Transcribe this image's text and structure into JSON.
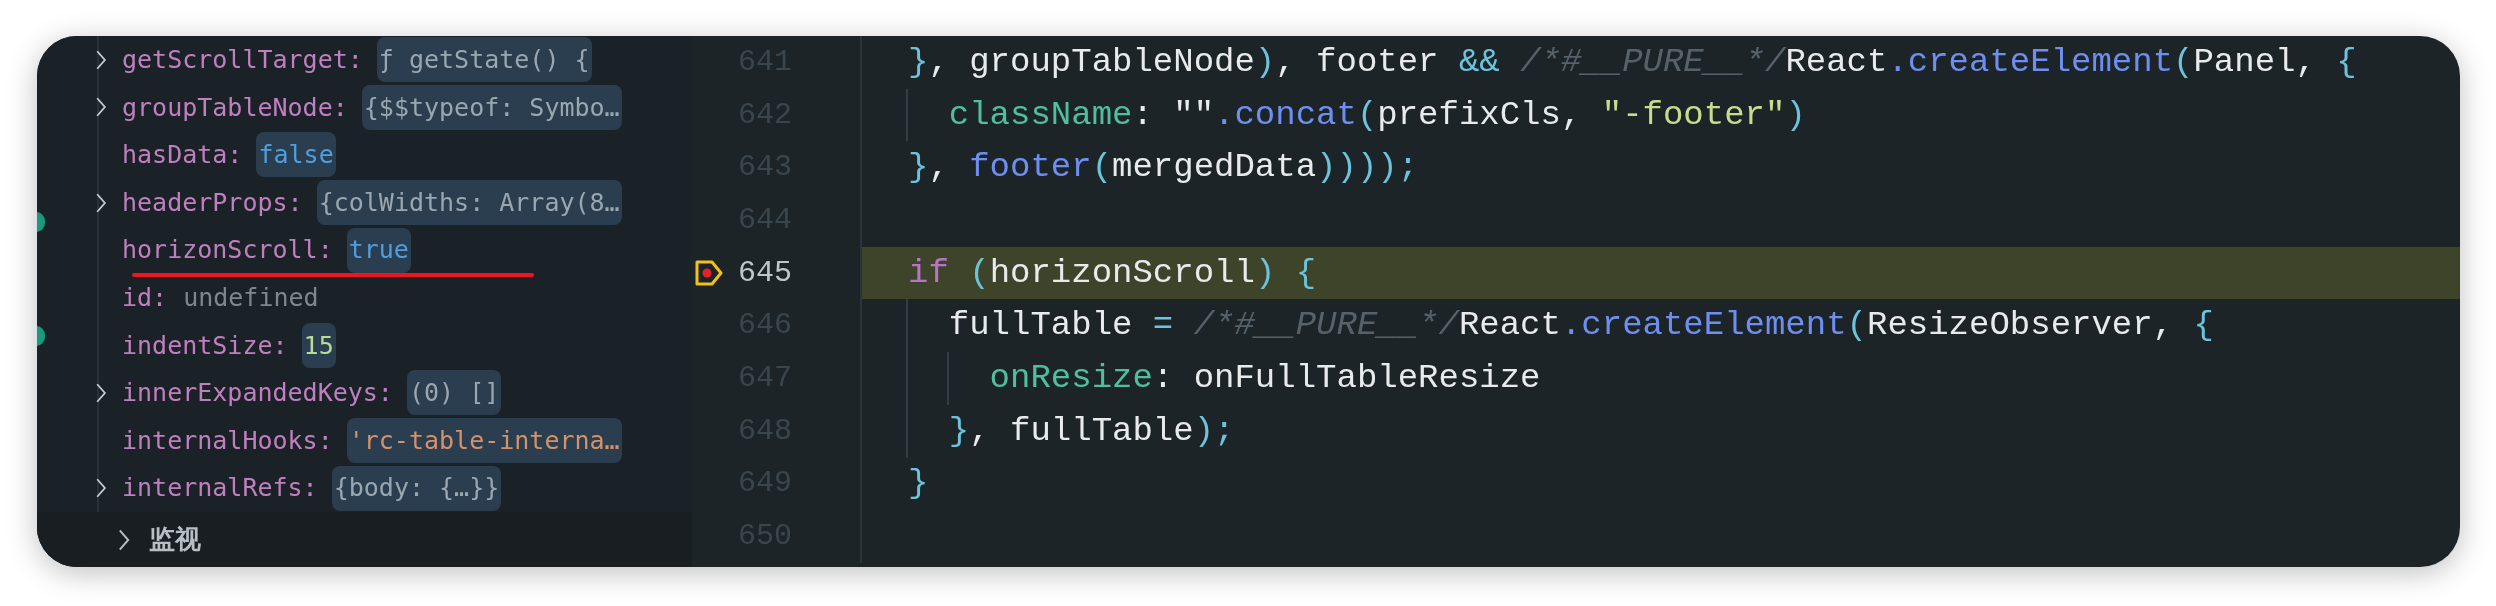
{
  "variables_panel": {
    "rows": [
      {
        "key": "getScrollTarget:",
        "value": "ƒ getState() {",
        "kind": "function",
        "expandable": true,
        "underlined": false
      },
      {
        "key": "groupTableNode:",
        "value": "{$$typeof: Symbo…",
        "kind": "object",
        "expandable": true,
        "underlined": false
      },
      {
        "key": "hasData:",
        "value": "false",
        "kind": "boolean",
        "expandable": false,
        "underlined": false
      },
      {
        "key": "headerProps:",
        "value": "{colWidths: Array(8…",
        "kind": "object",
        "expandable": true,
        "underlined": false
      },
      {
        "key": "horizonScroll:",
        "value": "true",
        "kind": "boolean",
        "expandable": false,
        "underlined": true
      },
      {
        "key": "id:",
        "value": "undefined",
        "kind": "undefined",
        "expandable": false,
        "underlined": false
      },
      {
        "key": "indentSize:",
        "value": "15",
        "kind": "number",
        "expandable": false,
        "underlined": false
      },
      {
        "key": "innerExpandedKeys:",
        "value": "(0) []",
        "kind": "array",
        "expandable": true,
        "underlined": false
      },
      {
        "key": "internalHooks:",
        "value": "'rc-table-interna…",
        "kind": "string",
        "expandable": false,
        "underlined": false
      },
      {
        "key": "internalRefs:",
        "value": "{body: {…}}",
        "kind": "object",
        "expandable": true,
        "underlined": false
      }
    ]
  },
  "watch_section": {
    "label": "监视",
    "expanded": false
  },
  "editor": {
    "lines": [
      {
        "number": "641",
        "current": false,
        "breakpoint": false,
        "tokens": [
          {
            "text": "}",
            "kind": "punct"
          },
          {
            "text": ", groupTableNode",
            "kind": "text"
          },
          {
            "text": ")",
            "kind": "punct"
          },
          {
            "text": ", footer ",
            "kind": "text"
          },
          {
            "text": "&& ",
            "kind": "punct"
          },
          {
            "text": "/*#__PURE__*/",
            "kind": "comment"
          },
          {
            "text": "React",
            "kind": "text"
          },
          {
            "text": ".createElement",
            "kind": "method"
          },
          {
            "text": "(",
            "kind": "punct"
          },
          {
            "text": "Panel, ",
            "kind": "text"
          },
          {
            "text": "{",
            "kind": "punct"
          }
        ]
      },
      {
        "number": "642",
        "current": false,
        "breakpoint": false,
        "tokens": [
          {
            "text": "  className",
            "kind": "property"
          },
          {
            "text": ": \"\"",
            "kind": "text"
          },
          {
            "text": ".concat",
            "kind": "method"
          },
          {
            "text": "(",
            "kind": "punct"
          },
          {
            "text": "prefixCls, ",
            "kind": "text"
          },
          {
            "text": "\"-footer\"",
            "kind": "string"
          },
          {
            "text": ")",
            "kind": "punct"
          }
        ]
      },
      {
        "number": "643",
        "current": false,
        "breakpoint": false,
        "tokens": [
          {
            "text": "}",
            "kind": "punct"
          },
          {
            "text": ", ",
            "kind": "text"
          },
          {
            "text": "footer",
            "kind": "method"
          },
          {
            "text": "(",
            "kind": "punct"
          },
          {
            "text": "mergedData",
            "kind": "text"
          },
          {
            "text": "))));",
            "kind": "punct"
          }
        ]
      },
      {
        "number": "644",
        "current": false,
        "breakpoint": false
      },
      {
        "number": "645",
        "current": true,
        "breakpoint": true,
        "tokens": [
          {
            "text": "if ",
            "kind": "keyword"
          },
          {
            "text": "(",
            "kind": "punct"
          },
          {
            "text": "horizonScroll",
            "kind": "text"
          },
          {
            "text": ") {",
            "kind": "punct"
          }
        ]
      },
      {
        "number": "646",
        "current": false,
        "breakpoint": false,
        "tokens": [
          {
            "text": "  fullTable ",
            "kind": "text"
          },
          {
            "text": "= ",
            "kind": "punct"
          },
          {
            "text": "/*#__PURE__*/",
            "kind": "comment"
          },
          {
            "text": "React",
            "kind": "text"
          },
          {
            "text": ".createElement",
            "kind": "method"
          },
          {
            "text": "(",
            "kind": "punct"
          },
          {
            "text": "ResizeObserver, ",
            "kind": "text"
          },
          {
            "text": "{",
            "kind": "punct"
          }
        ]
      },
      {
        "number": "647",
        "current": false,
        "breakpoint": false,
        "tokens": [
          {
            "text": "    onResize",
            "kind": "property"
          },
          {
            "text": ": onFullTableResize",
            "kind": "text"
          }
        ]
      },
      {
        "number": "648",
        "current": false,
        "breakpoint": false,
        "tokens": [
          {
            "text": "  }",
            "kind": "punct"
          },
          {
            "text": ", fullTable",
            "kind": "text"
          },
          {
            "text": ");",
            "kind": "punct"
          }
        ]
      },
      {
        "number": "649",
        "current": false,
        "breakpoint": false,
        "tokens": [
          {
            "text": "}",
            "kind": "punct"
          }
        ]
      },
      {
        "number": "650",
        "current": false,
        "breakpoint": false
      }
    ]
  }
}
